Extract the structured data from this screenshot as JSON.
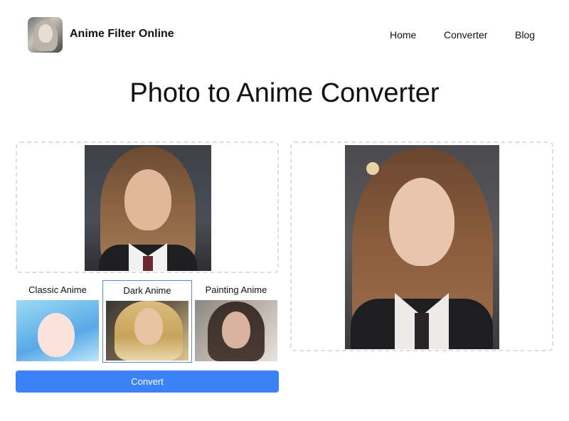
{
  "header": {
    "brand": "Anime Filter Online",
    "logo_icon": "anime-girl-avatar-icon",
    "nav": [
      {
        "label": "Home"
      },
      {
        "label": "Converter"
      },
      {
        "label": "Blog"
      }
    ]
  },
  "main": {
    "title": "Photo to Anime Converter",
    "styles": [
      {
        "label": "Classic Anime",
        "selected": false
      },
      {
        "label": "Dark Anime",
        "selected": true
      },
      {
        "label": "Painting Anime",
        "selected": false
      }
    ],
    "convert_label": "Convert"
  },
  "colors": {
    "accent": "#3b82f6",
    "selected_border": "#5a8fd6",
    "dropzone_border": "#dedede"
  }
}
